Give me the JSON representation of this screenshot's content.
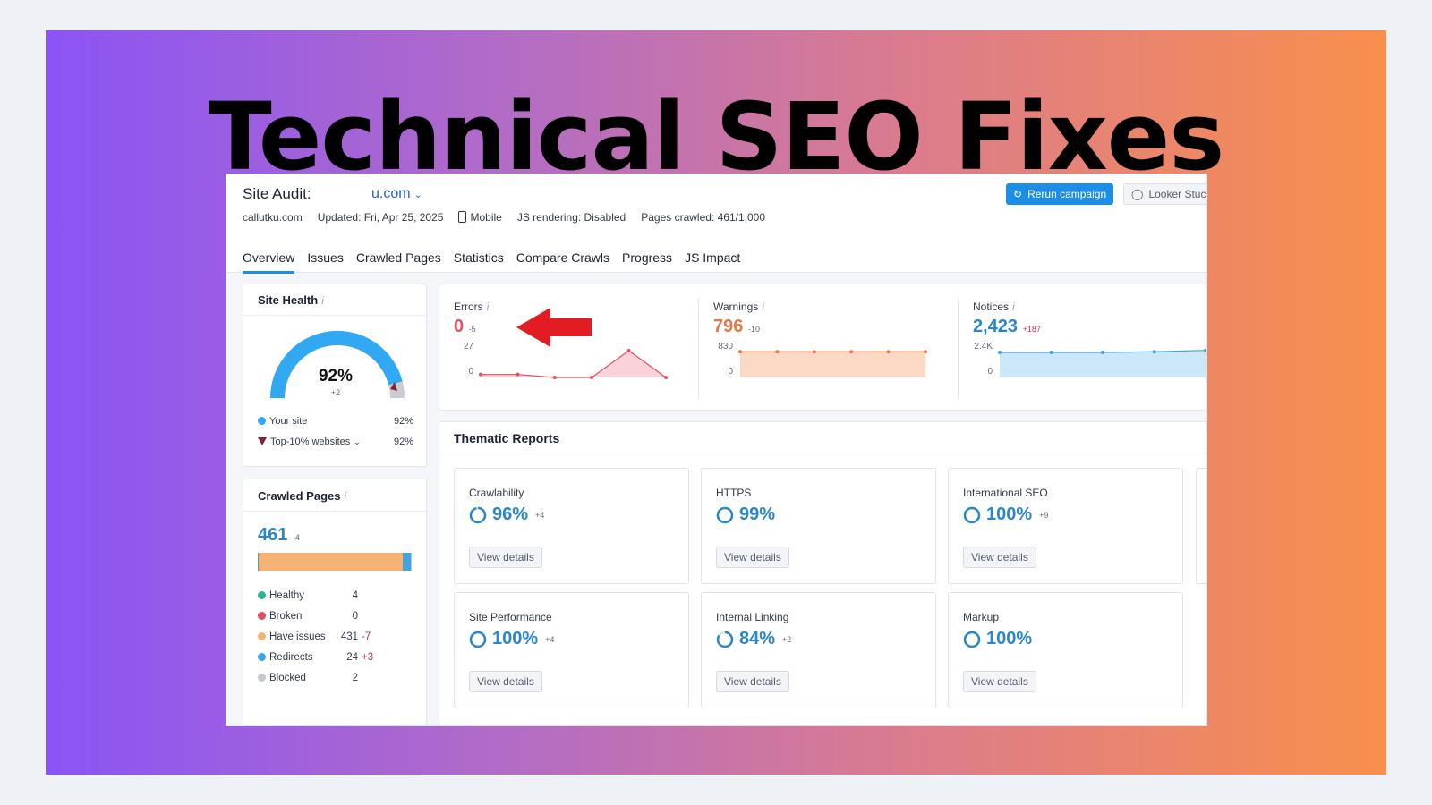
{
  "banner": {
    "title": "Technical SEO Fixes"
  },
  "header": {
    "audit_label": "Site Audit:",
    "domain": "u.com",
    "site": "callutku.com",
    "updated": "Updated: Fri, Apr 25, 2025",
    "device": "Mobile",
    "js_rendering": "JS rendering: Disabled",
    "pages_crawled": "Pages crawled: 461/1,000",
    "rerun_label": "Rerun campaign",
    "looker_label": "Looker Stuc"
  },
  "tabs": [
    {
      "label": "Overview",
      "active": true
    },
    {
      "label": "Issues"
    },
    {
      "label": "Crawled Pages"
    },
    {
      "label": "Statistics"
    },
    {
      "label": "Compare Crawls"
    },
    {
      "label": "Progress"
    },
    {
      "label": "JS Impact"
    }
  ],
  "site_health": {
    "title": "Site Health",
    "value": "92%",
    "percent": 92,
    "delta": "+2",
    "your_site_label": "Your site",
    "your_site_value": "92%",
    "top10_label": "Top-10% websites",
    "top10_value": "92%"
  },
  "crawled_pages": {
    "title": "Crawled Pages",
    "total": "461",
    "delta": "-4",
    "rows": [
      {
        "label": "Healthy",
        "value": "4",
        "delta": "",
        "color": "#2bb39a",
        "count": 4
      },
      {
        "label": "Broken",
        "value": "0",
        "delta": "",
        "color": "#d9505e",
        "count": 0
      },
      {
        "label": "Have issues",
        "value": "431",
        "delta": "-7",
        "color": "#f5b272",
        "count": 431
      },
      {
        "label": "Redirects",
        "value": "24",
        "delta": "+3",
        "color": "#3fa4e0",
        "count": 24
      },
      {
        "label": "Blocked",
        "value": "2",
        "delta": "",
        "color": "#c3c7cd",
        "count": 2
      }
    ]
  },
  "metrics": [
    {
      "name": "errors",
      "title": "Errors",
      "value": "0",
      "delta": "-5",
      "color": "#e0505e",
      "fill": "#f9d3d8",
      "y_top": "27",
      "y_bottom": "0",
      "series": [
        3,
        3,
        0,
        0,
        27,
        0
      ],
      "ymax": 27
    },
    {
      "name": "warnings",
      "title": "Warnings",
      "value": "796",
      "delta": "-10",
      "color": "#e07a4a",
      "fill": "#fbd9c4",
      "y_top": "830",
      "y_bottom": "0",
      "series": [
        796,
        796,
        796,
        796,
        796,
        796
      ],
      "ymax": 830
    },
    {
      "name": "notices",
      "title": "Notices",
      "value": "2,423",
      "delta": "+187",
      "color": "#3fa4e0",
      "fill": "#cbe7f8",
      "y_top": "2.4K",
      "y_bottom": "0",
      "series": [
        2236,
        2236,
        2236,
        2300,
        2423
      ],
      "ymax": 2400
    }
  ],
  "thematic": {
    "title": "Thematic Reports",
    "view_details_label": "View details",
    "reports": [
      {
        "title": "Crawlability",
        "value": "96%",
        "percent": 96,
        "delta": "+4"
      },
      {
        "title": "HTTPS",
        "value": "99%",
        "percent": 99,
        "delta": ""
      },
      {
        "title": "International SEO",
        "value": "100%",
        "percent": 100,
        "delta": "+9"
      },
      {
        "title": "Site Performance",
        "value": "100%",
        "percent": 100,
        "delta": "+4"
      },
      {
        "title": "Internal Linking",
        "value": "84%",
        "percent": 84,
        "delta": "+2"
      },
      {
        "title": "Markup",
        "value": "100%",
        "percent": 100,
        "delta": ""
      }
    ]
  },
  "colors": {
    "accent": "#1e8de6",
    "gauge": "#31a8f2",
    "gauge_bg": "#c9ccd1"
  }
}
